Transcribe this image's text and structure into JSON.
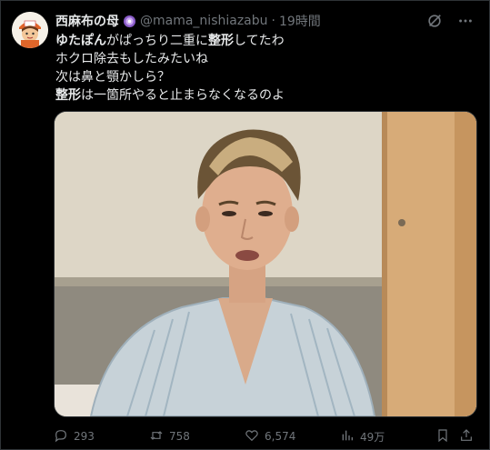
{
  "post": {
    "author_name": "西麻布の母",
    "handle": "@mama_nishiazabu",
    "separator": "·",
    "time": "19時間",
    "lines": [
      {
        "bold": "ゆたぽん",
        "rest": "がぱっちり二重に"
      },
      {
        "bold2": "整形",
        "rest2": "してたわ"
      }
    ],
    "line1_a": "ゆたぽん",
    "line1_b": "がぱっちり二重に",
    "line1_c": "整形",
    "line1_d": "してたわ",
    "line2": "ホクロ除去もしたみたいね",
    "line3": "次は鼻と顎かしら？",
    "line4_a": "整形",
    "line4_b": "は一箇所やると止まらなくなるのよ"
  },
  "actions": {
    "replies": "293",
    "reposts": "758",
    "likes": "6,574",
    "views": "49万"
  },
  "icons": {
    "top": [
      "grok-icon",
      "more-icon"
    ],
    "actions": [
      "reply-icon",
      "repost-icon",
      "like-icon",
      "views-icon",
      "bookmark-icon",
      "share-icon"
    ]
  },
  "colors": {
    "background": "#000000",
    "text": "#e7e9ea",
    "muted": "#71767b",
    "border": "#2f3336"
  }
}
